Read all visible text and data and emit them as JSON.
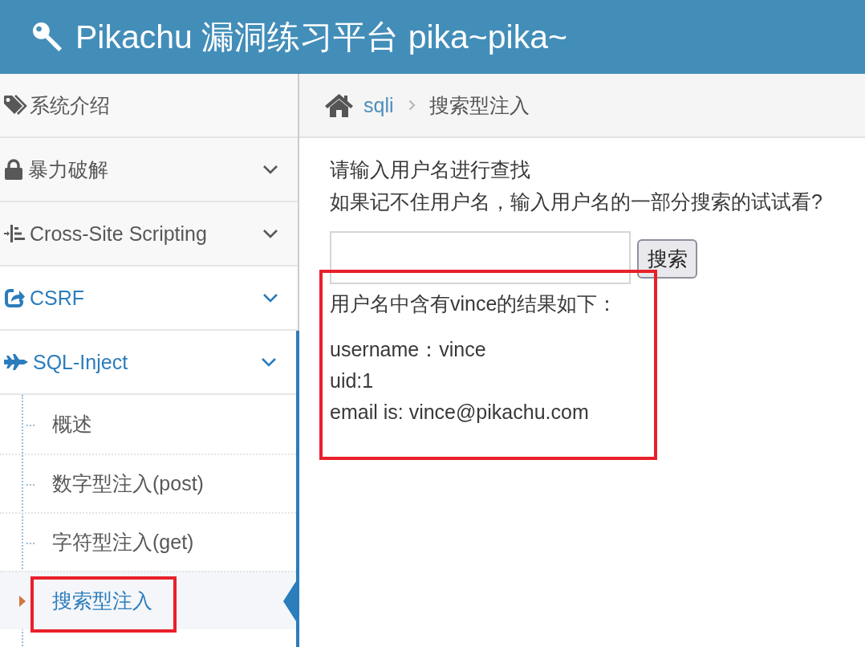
{
  "header": {
    "title": "Pikachu 漏洞练习平台 pika~pika~"
  },
  "sidebar": {
    "items": [
      {
        "label": "系统介绍",
        "has_submenu": false,
        "hovered": false,
        "expanded": false
      },
      {
        "label": "暴力破解",
        "has_submenu": true,
        "hovered": false,
        "expanded": false
      },
      {
        "label": "Cross-Site Scripting",
        "has_submenu": true,
        "hovered": false,
        "expanded": false
      },
      {
        "label": "CSRF",
        "has_submenu": true,
        "hovered": true,
        "expanded": false
      },
      {
        "label": "SQL-Inject",
        "has_submenu": true,
        "hovered": false,
        "expanded": true,
        "children": [
          {
            "label": "概述",
            "selected": false,
            "annotated": false
          },
          {
            "label": "数字型注入(post)",
            "selected": false,
            "annotated": false
          },
          {
            "label": "字符型注入(get)",
            "selected": false,
            "annotated": false
          },
          {
            "label": "搜索型注入",
            "selected": true,
            "annotated": true
          }
        ]
      }
    ]
  },
  "breadcrumb": {
    "items": [
      {
        "label": "sqli",
        "kind": "link"
      },
      {
        "label": "搜索型注入",
        "kind": "current"
      }
    ]
  },
  "search": {
    "instructions": [
      "请输入用户名进行查找",
      "如果记不住用户名，输入用户名的一部分搜索的试试看?"
    ],
    "button": "搜索"
  },
  "result": {
    "heading": "用户名中含有vince的结果如下：",
    "lines": [
      "username：vince",
      "uid:1",
      "email is: vince@pikachu.com"
    ],
    "annotated": true
  }
}
